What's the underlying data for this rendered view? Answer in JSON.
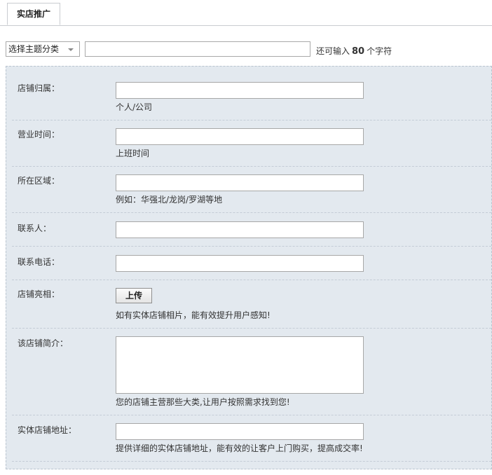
{
  "tabs": [
    {
      "label": "实店推广"
    }
  ],
  "title_bar": {
    "category_select": "选择主题分类",
    "title_value": "",
    "counter_prefix": "还可输入",
    "counter_value": "80",
    "counter_suffix": "个字符"
  },
  "form": {
    "fields": [
      {
        "label": "店铺归属：",
        "value": "",
        "hint": "个人/公司"
      },
      {
        "label": "营业时间：",
        "value": "",
        "hint": "上班时间"
      },
      {
        "label": "所在区域：",
        "value": "",
        "hint": "例如：华强北/龙岗/罗湖等地"
      },
      {
        "label": "联系人：",
        "value": ""
      },
      {
        "label": "联系电话：",
        "value": ""
      },
      {
        "label": "店铺亮相：",
        "button": "上传",
        "hint": "如有实体店铺相片，能有效提升用户感知!"
      },
      {
        "label": "该店铺简介：",
        "value": "",
        "hint": "您的店铺主营那些大类,让用户按照需求找到您!"
      },
      {
        "label": "实体店铺地址：",
        "value": "",
        "hint": "提供详细的实体店铺地址，能有效的让客户上门购买，提高成交率!"
      }
    ]
  }
}
